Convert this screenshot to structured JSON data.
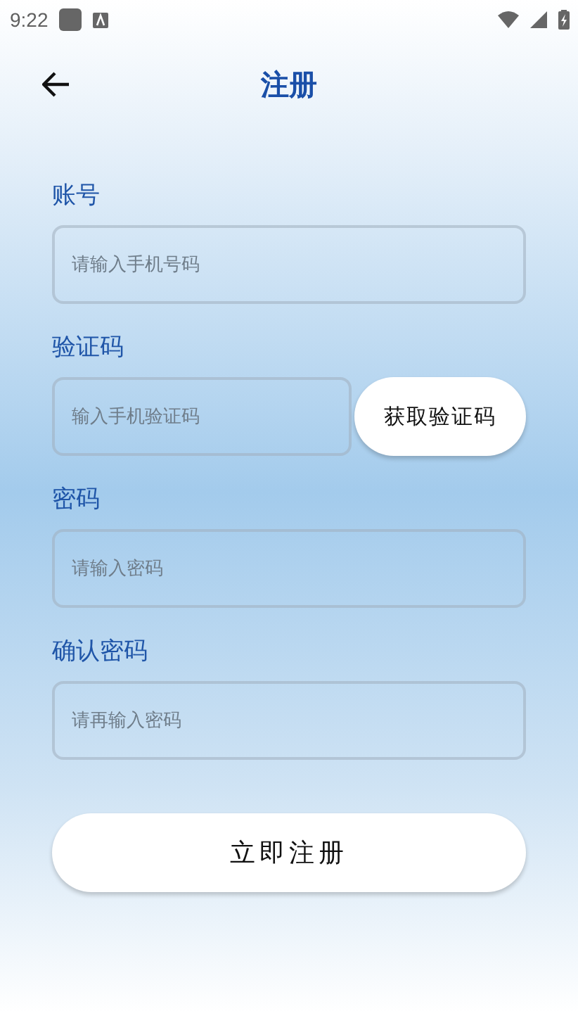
{
  "status_bar": {
    "time": "9:22"
  },
  "header": {
    "title": "注册"
  },
  "fields": [
    {
      "label": "账号",
      "placeholder": "请输入手机号码"
    },
    {
      "label": "验证码",
      "placeholder": "输入手机验证码",
      "action": "获取验证码"
    },
    {
      "label": "密码",
      "placeholder": "请输入密码"
    },
    {
      "label": "确认密码",
      "placeholder": "请再输入密码"
    }
  ],
  "submit": "立即注册"
}
